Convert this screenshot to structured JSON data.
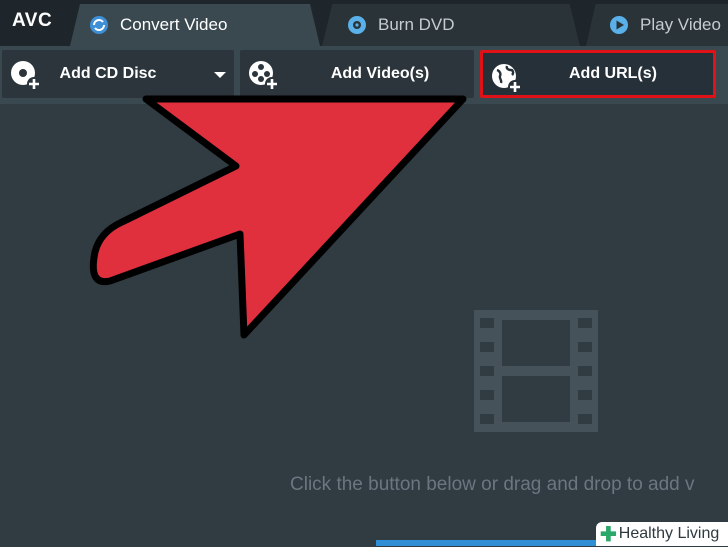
{
  "app": {
    "logo": "AVC"
  },
  "tabs": [
    {
      "label": "Convert Video",
      "icon": "convert-icon"
    },
    {
      "label": "Burn DVD",
      "icon": "disc-icon"
    },
    {
      "label": "Play Video",
      "icon": "play-icon"
    }
  ],
  "toolbar": {
    "add_cd_label": "Add CD Disc",
    "add_video_label": "Add Video(s)",
    "add_url_label": "Add URL(s)"
  },
  "workspace": {
    "hint": "Click the button below or drag and drop to add v"
  },
  "watermark": {
    "text": "Healthy Living"
  },
  "colors": {
    "accent": "#2f8ed4",
    "highlight_box": "#e01218",
    "arrow": "#e0303e"
  }
}
